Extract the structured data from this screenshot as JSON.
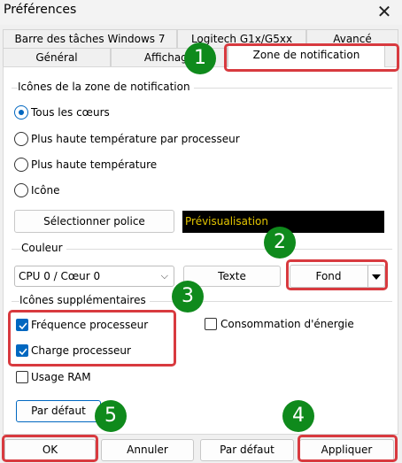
{
  "window": {
    "title": "Préférences"
  },
  "tabs": {
    "row1": [
      "Barre des tâches Windows 7",
      "Logitech G1x/G5xx",
      "Avancé"
    ],
    "row2": [
      "Général",
      "Affichage",
      "Zone de notification"
    ]
  },
  "tray_icons": {
    "title": "Icônes de la zone de notification",
    "options": [
      "Tous les cœurs",
      "Plus haute température par processeur",
      "Plus haute température",
      "Icône"
    ],
    "selected": "Tous les cœurs",
    "select_font_label": "Sélectionner police",
    "preview_text": "Prévisualisation"
  },
  "color": {
    "title": "Couleur",
    "core_select": "CPU 0 / Cœur 0",
    "text_button": "Texte",
    "background_button": "Fond"
  },
  "extra_icons": {
    "title": "Icônes supplémentaires",
    "processor_frequency": {
      "label": "Fréquence processeur",
      "checked": true
    },
    "processor_load": {
      "label": "Charge processeur",
      "checked": true
    },
    "power_consumption": {
      "label": "Consommation d'énergie",
      "checked": false
    },
    "ram_usage": {
      "label": "Usage RAM",
      "checked": false
    },
    "default_button": "Par défaut"
  },
  "footer": {
    "ok": "OK",
    "cancel": "Annuler",
    "default": "Par défaut",
    "apply": "Appliquer"
  },
  "badges": [
    "1",
    "2",
    "3",
    "4",
    "5"
  ],
  "colors": {
    "highlight": "#d83a3f",
    "badge": "#0f8a1c",
    "accent": "#0067c0",
    "preview_text": "#e2c400"
  }
}
